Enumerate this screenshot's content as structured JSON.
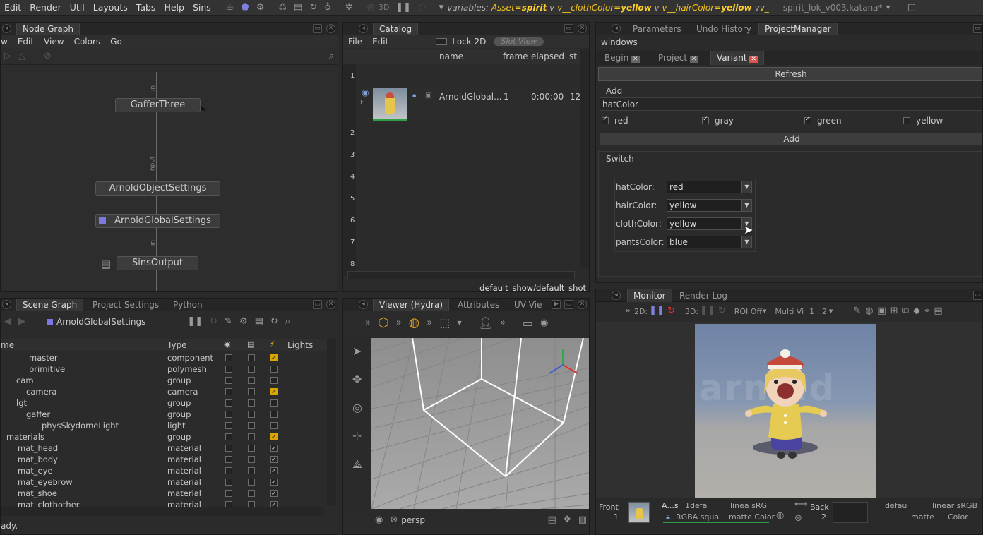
{
  "menubar": {
    "items": [
      "Edit",
      "Render",
      "Util",
      "Layouts",
      "Tabs",
      "Help",
      "Sins"
    ],
    "threeD": "3D:",
    "variables": {
      "label": "variables:",
      "assetKey": "Asset",
      "assetVal": "spirit",
      "clothKey": "v__clothColor",
      "clothVal": "yellow",
      "hairKey": "v__hairColor",
      "hairVal": "yellow",
      "tail": "v_"
    },
    "file": "spirit_lok_v003.katana*"
  },
  "nodegraph": {
    "tab": "Node Graph",
    "menu": [
      "w",
      "Edit",
      "View",
      "Colors",
      "Go"
    ],
    "nodes": [
      "GafferThree",
      "ArnoldObjectSettings",
      "ArnoldGlobalSettings",
      "SinsOutput"
    ],
    "wire_labels": [
      "in",
      "input",
      "in"
    ]
  },
  "catalog": {
    "tab": "Catalog",
    "menu": [
      "File",
      "Edit"
    ],
    "lock2d": "Lock 2D",
    "slotview": "Slot View",
    "columns": [
      "name",
      "frame",
      "elapsed",
      "st"
    ],
    "row": {
      "name": "ArnoldGlobal...",
      "frame": "1",
      "elapsed": "0:00:00",
      "extra": "12"
    },
    "row_numbers": [
      "1",
      "2",
      "3",
      "4",
      "5",
      "6",
      "7",
      "8"
    ],
    "flag": "F",
    "footer": "default_show/default_shot"
  },
  "params": {
    "tabs": [
      "Parameters",
      "Undo History",
      "ProjectManager"
    ],
    "windows": "windows",
    "subtabs": [
      "Begin",
      "Project",
      "Variant"
    ],
    "refresh": "Refresh",
    "add_group": "Add",
    "hat_input": "hatColor",
    "colors": [
      {
        "name": "red",
        "checked": true
      },
      {
        "name": "gray",
        "checked": true
      },
      {
        "name": "green",
        "checked": true
      },
      {
        "name": "yellow",
        "checked": false
      }
    ],
    "add_btn": "Add",
    "switch_group": "Switch",
    "switches": [
      {
        "label": "hatColor:",
        "value": "red"
      },
      {
        "label": "hairColor:",
        "value": "yellow"
      },
      {
        "label": "clothColor:",
        "value": "yellow"
      },
      {
        "label": "pantsColor:",
        "value": "blue"
      }
    ]
  },
  "scenegraph": {
    "tabs": [
      "Scene Graph",
      "Project Settings",
      "Python"
    ],
    "location": "ArnoldGlobalSettings",
    "columns": [
      "me",
      "Type",
      "Lights"
    ],
    "rows": [
      {
        "name": "master",
        "type": "component",
        "indent": 40,
        "c3": "yel"
      },
      {
        "name": "primitive",
        "type": "polymesh",
        "indent": 40,
        "c3": ""
      },
      {
        "name": "cam",
        "type": "group",
        "indent": 22,
        "c3": ""
      },
      {
        "name": "camera",
        "type": "camera",
        "indent": 36,
        "c3": "yel"
      },
      {
        "name": "lgt",
        "type": "group",
        "indent": 22,
        "c3": ""
      },
      {
        "name": "gaffer",
        "type": "group",
        "indent": 36,
        "c3": ""
      },
      {
        "name": "physSkydomeLight",
        "type": "light",
        "indent": 58,
        "c3": ""
      },
      {
        "name": "materials",
        "type": "group",
        "indent": 8,
        "c3": "yel"
      },
      {
        "name": "mat_head",
        "type": "material",
        "indent": 24,
        "c3": "on"
      },
      {
        "name": "mat_body",
        "type": "material",
        "indent": 24,
        "c3": "on"
      },
      {
        "name": "mat_eye",
        "type": "material",
        "indent": 24,
        "c3": "on"
      },
      {
        "name": "mat_eyebrow",
        "type": "material",
        "indent": 24,
        "c3": "on"
      },
      {
        "name": "mat_shoe",
        "type": "material",
        "indent": 24,
        "c3": "on"
      },
      {
        "name": "mat_clothother",
        "type": "material",
        "indent": 24,
        "c3": "on"
      }
    ],
    "status": "ady."
  },
  "viewer": {
    "tabs": [
      "Viewer (Hydra)",
      "Attributes",
      "UV Vie"
    ],
    "camera": "persp"
  },
  "monitor": {
    "tabs": [
      "Monitor",
      "Render Log"
    ],
    "d2": "2D:",
    "d3": "3D:",
    "roi": "ROI Off",
    "multi": "Multi Vi",
    "ratio": "1 : 2",
    "front_label": "Front",
    "front_num": "1",
    "a_label": "A...s",
    "one_def": "1defa",
    "linear": "linea sRG",
    "rgba": "RGBA squa",
    "matte": "matte Color",
    "back_label": "Back",
    "back_num": "2",
    "defau": "defau",
    "linear2": "linear sRGB",
    "matte2": "matte",
    "color2": "Color",
    "watermark": "arnold"
  }
}
